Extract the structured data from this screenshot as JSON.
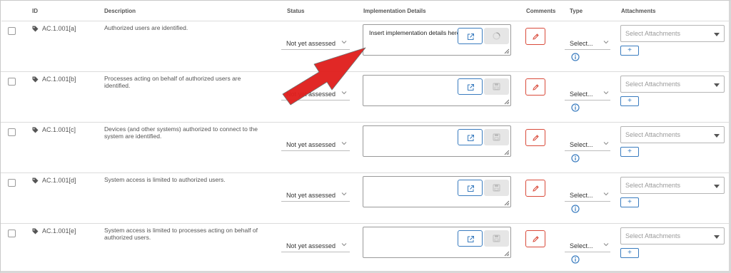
{
  "columns": {
    "id": "ID",
    "description": "Description",
    "status": "Status",
    "implementation": "Implementation Details",
    "comments": "Comments",
    "type": "Type",
    "attachments": "Attachments"
  },
  "rows": [
    {
      "id": "AC.1.001[a]",
      "description": "Authorized users are identified.",
      "status": "Not yet assessed",
      "implementation_text": "Insert implementation details here",
      "save_state": "loading",
      "type": "Select...",
      "attachments_placeholder": "Select Attachments",
      "add_label": "+"
    },
    {
      "id": "AC.1.001[b]",
      "description": "Processes acting on behalf of authorized users are identified.",
      "status": "Not yet assessed",
      "implementation_text": "",
      "save_state": "disabled",
      "type": "Select...",
      "attachments_placeholder": "Select Attachments",
      "add_label": "+"
    },
    {
      "id": "AC.1.001[c]",
      "description": "Devices (and other systems) authorized to connect to the system are identified.",
      "status": "Not yet assessed",
      "implementation_text": "",
      "save_state": "disabled",
      "type": "Select...",
      "attachments_placeholder": "Select Attachments",
      "add_label": "+"
    },
    {
      "id": "AC.1.001[d]",
      "description": "System access is limited to authorized users.",
      "status": "Not yet assessed",
      "implementation_text": "",
      "save_state": "disabled",
      "type": "Select...",
      "attachments_placeholder": "Select Attachments",
      "add_label": "+"
    },
    {
      "id": "AC.1.001[e]",
      "description": "System access is limited to processes acting on behalf of authorized users.",
      "status": "Not yet assessed",
      "implementation_text": "",
      "save_state": "disabled",
      "type": "Select...",
      "attachments_placeholder": "Select Attachments",
      "add_label": "+"
    }
  ],
  "icons": {
    "id_tag": "tag-icon",
    "status_dropdown": "chevron-down-icon",
    "open_editor": "external-link-icon",
    "save": "save-icon",
    "comment": "pencil-icon",
    "type_info": "info-icon",
    "attachments_dropdown": "caret-down-icon",
    "annotation": "red-arrow-icon"
  },
  "colors": {
    "primary_blue": "#3a7cbf",
    "comment_red": "#d94a3a",
    "annotation_arrow": "#e0201e",
    "row_divider": "#dcdcdc"
  }
}
